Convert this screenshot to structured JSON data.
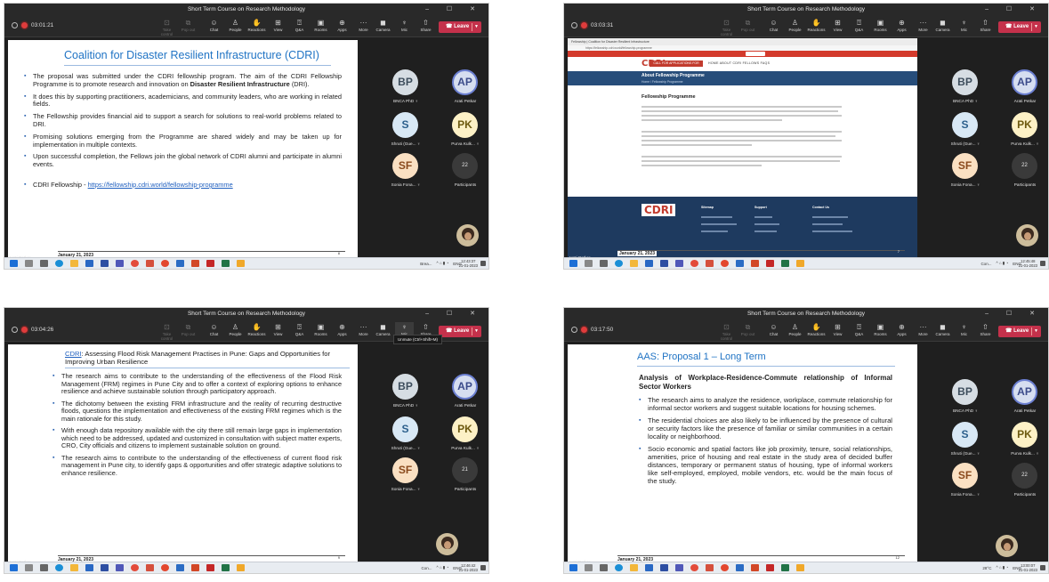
{
  "meeting": {
    "title": "Short Term Course on Research Methodology",
    "window_controls": "–  ☐  ✕",
    "toolbar": {
      "take_control": "Take control",
      "pop_out": "Pop out",
      "chat": "Chat",
      "people": "People",
      "reactions": "Reactions",
      "view": "View",
      "qa": "Q&A",
      "rooms": "Rooms",
      "apps": "Apps",
      "more": "More",
      "camera": "Camera",
      "mic": "Mic",
      "share": "Share",
      "leave": "Leave"
    },
    "participants": [
      {
        "initials": "BP",
        "name": "BNCA PhD"
      },
      {
        "initials": "AP",
        "name": "Arati Petkar"
      },
      {
        "initials": "S",
        "name": "Shruti (Gue..."
      },
      {
        "initials": "PK",
        "name": "Purva Kulk..."
      },
      {
        "initials": "SF",
        "name": "Sonia Fona..."
      }
    ],
    "participants_label": "Participants",
    "speaker": "Arati Petkar",
    "mic_tooltip": "Unmute (Ctrl+Shift+M)"
  },
  "panels": [
    {
      "timer": "03:01:21",
      "more_count": "22",
      "clock_time": "12:43:37",
      "clock_date": "21-01-2023",
      "tray_text": "Brea...",
      "lang": "ENG",
      "slide": {
        "title": "Coalition for Disaster Resilient Infrastructure (CDRI)",
        "bullets": [
          "The proposal was submitted under the CDRI fellowship program. The aim of the CDRI Fellowship Programme is to promote research and innovation on Disaster Resilient Infrastructure (DRI).",
          "It does this by supporting practitioners, academicians, and community leaders, who are working in related fields.",
          "The Fellowship provides financial aid to support a search for solutions to real-world problems related to DRI.",
          "Promising solutions emerging from the Programme are shared widely and may be taken up for implementation in multiple contexts.",
          "Upon successful completion, the Fellows join the global network of CDRI alumni and participate in alumni events."
        ],
        "link_prefix": "CDRI Fellowship - ",
        "link": "https://fellowship.cdri.world/fellowship-programme",
        "date": "January 21, 2023",
        "page": "8"
      }
    },
    {
      "timer": "03:03:31",
      "more_count": "22",
      "clock_time": "12:45:48",
      "clock_date": "21-01-2023",
      "tray_text": "Con...",
      "lang": "ENG",
      "web": {
        "tab": "Fellowship | Coalition for Disaster Resilient Infrastructure",
        "address": "https://fellowship.cdri.world/fellowship-programme",
        "logo": "CDRI",
        "cta": "CALL FOR APPLICATIONS FOR COHORT 2023-24",
        "menu": "HOME   ABOUT   CDRI FELLOWS   FAQS",
        "band_title": "About Fellowship Programme",
        "breadcrumb": "Home  /  Fellowship Programme",
        "heading": "Fellowship Programme",
        "footer_cols": [
          "Sitemap",
          "Support",
          "Contact Us"
        ]
      },
      "date": "January 21, 2023",
      "page": "7"
    },
    {
      "timer": "03:04:26",
      "more_count": "21",
      "clock_time": "12:46:42",
      "clock_date": "21-01-2023",
      "tray_text": "Con...",
      "lang": "ENG",
      "slide": {
        "title_link": "CDRI",
        "title_rest": ": Assessing Flood Risk Management Practises in Pune: Gaps and Opportunities for Improving Urban Resilience",
        "bullets": [
          "The research aims to contribute to the understanding of the effectiveness of the Flood Risk Management (FRM) regimes in Pune City and to offer a context of exploring options to enhance resilience and achieve sustainable solution through participatory approach.",
          "The dichotomy between the existing FRM infrastructure and the reality of recurring destructive floods, questions the implementation and effectiveness of the existing FRM regimes which is the main rationale for this study.",
          "With enough data repository available with the city there still remain large gaps in implementation which need to be addressed, updated and customized in consultation with subject matter experts, CRO, City officials and citizens to implement sustainable solution on ground.",
          "The research aims to contribute to the understanding of the effectiveness of current flood risk management in Pune city, to identify gaps & opportunities and offer strategic adaptive solutions to enhance resilience."
        ],
        "date": "January 21, 2023",
        "page": "9"
      }
    },
    {
      "timer": "03:17:50",
      "more_count": "22",
      "clock_time": "13:00:07",
      "clock_date": "21-01-2023",
      "tray_text": "28°C",
      "lang": "ENG",
      "slide": {
        "title": "AAS: Proposal 1 – Long Term",
        "subtitle": "Analysis of Workplace-Residence-Commute relationship of Informal Sector Workers",
        "bullets": [
          "The research aims to analyze the residence, workplace, commute relationship for informal sector workers and suggest suitable locations for housing schemes.",
          "The residential choices are also likely to be influenced by the presence of cultural or security factors like the presence of familiar or similar communities in a certain locality or neighborhood.",
          "Socio economic and spatial factors like job proximity, tenure, social relationships, amenities, price of housing and real estate in the study area of decided buffer distances, temporary or permanent status of housing, type of informal workers like self-employed, employed, mobile vendors, etc. would be the main focus of the study."
        ],
        "date": "January 21, 2023",
        "page": "12"
      }
    }
  ]
}
